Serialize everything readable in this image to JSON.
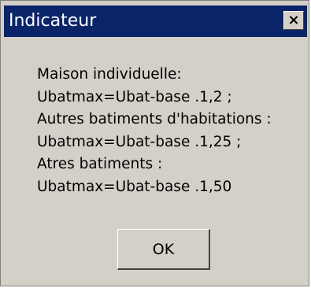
{
  "window": {
    "title": "Indicateur",
    "close_label": "×"
  },
  "message": {
    "lines": [
      "Maison individuelle:",
      "Ubatmax=Ubat-base .1,2 ;",
      "Autres batiments d'habitations :",
      "Ubatmax=Ubat-base .1,25 ;",
      "Atres batiments :",
      "Ubatmax=Ubat-base .1,50"
    ]
  },
  "buttons": {
    "ok_label": "OK"
  },
  "colors": {
    "titlebar": "#0a246a",
    "dialog_bg": "#d4d0c8",
    "title_text": "#ffffff"
  }
}
